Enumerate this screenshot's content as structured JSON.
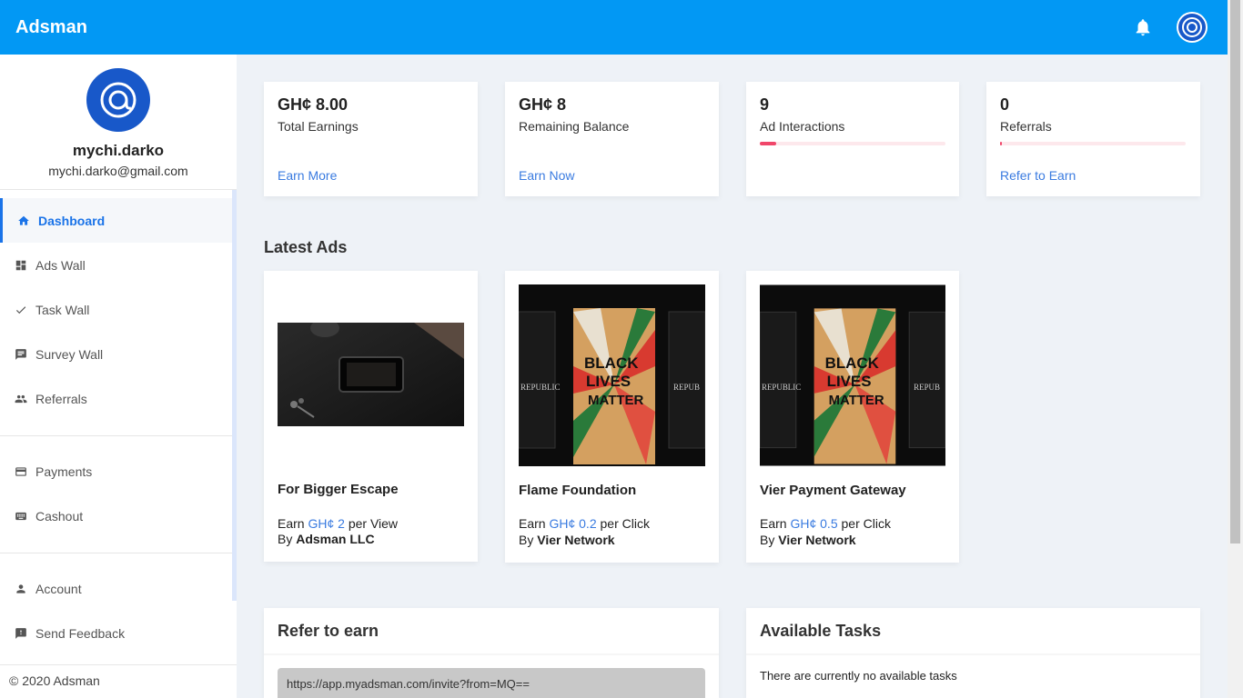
{
  "brand": "Adsman",
  "user": {
    "name": "mychi.darko",
    "email": "mychi.darko@gmail.com"
  },
  "nav": {
    "dashboard": "Dashboard",
    "ads_wall": "Ads Wall",
    "task_wall": "Task Wall",
    "survey_wall": "Survey Wall",
    "referrals": "Referrals",
    "payments": "Payments",
    "cashout": "Cashout",
    "account": "Account",
    "send_feedback": "Send Feedback"
  },
  "copyright": "© 2020 Adsman",
  "stats": [
    {
      "value": "GH¢ 8.00",
      "label": "Total Earnings",
      "link": "Earn More"
    },
    {
      "value": "GH¢ 8",
      "label": "Remaining Balance",
      "link": "Earn Now"
    },
    {
      "value": "9",
      "label": "Ad Interactions",
      "progress": 0.09
    },
    {
      "value": "0",
      "label": "Referrals",
      "link": "Refer to Earn",
      "progress": 0.01
    }
  ],
  "latest_ads_title": "Latest Ads",
  "ads": [
    {
      "title": "For Bigger Escape",
      "earn_prefix": "Earn ",
      "amount": "GH¢ 2",
      "per": " per View",
      "by_prefix": "By ",
      "by": "Adsman LLC"
    },
    {
      "title": "Flame Foundation",
      "earn_prefix": "Earn ",
      "amount": "GH¢ 0.2",
      "per": " per Click",
      "by_prefix": "By ",
      "by": "Vier Network"
    },
    {
      "title": "Vier Payment Gateway",
      "earn_prefix": "Earn ",
      "amount": "GH¢ 0.5",
      "per": " per Click",
      "by_prefix": "By ",
      "by": "Vier Network"
    }
  ],
  "ad_images": {
    "poster_text": [
      "BLACK",
      "LIVES",
      "MATTER"
    ],
    "sign_left": "REPUBLIC",
    "sign_right": "REPUB"
  },
  "refer": {
    "title": "Refer to earn",
    "invite_url": "https://app.myadsman.com/invite?from=MQ=="
  },
  "tasks": {
    "title": "Available Tasks",
    "empty": "There are currently no available tasks"
  },
  "colors": {
    "primary": "#0298f4",
    "link": "#3a7be0",
    "progress": "#f0466a",
    "avatar": "#1858c9"
  }
}
